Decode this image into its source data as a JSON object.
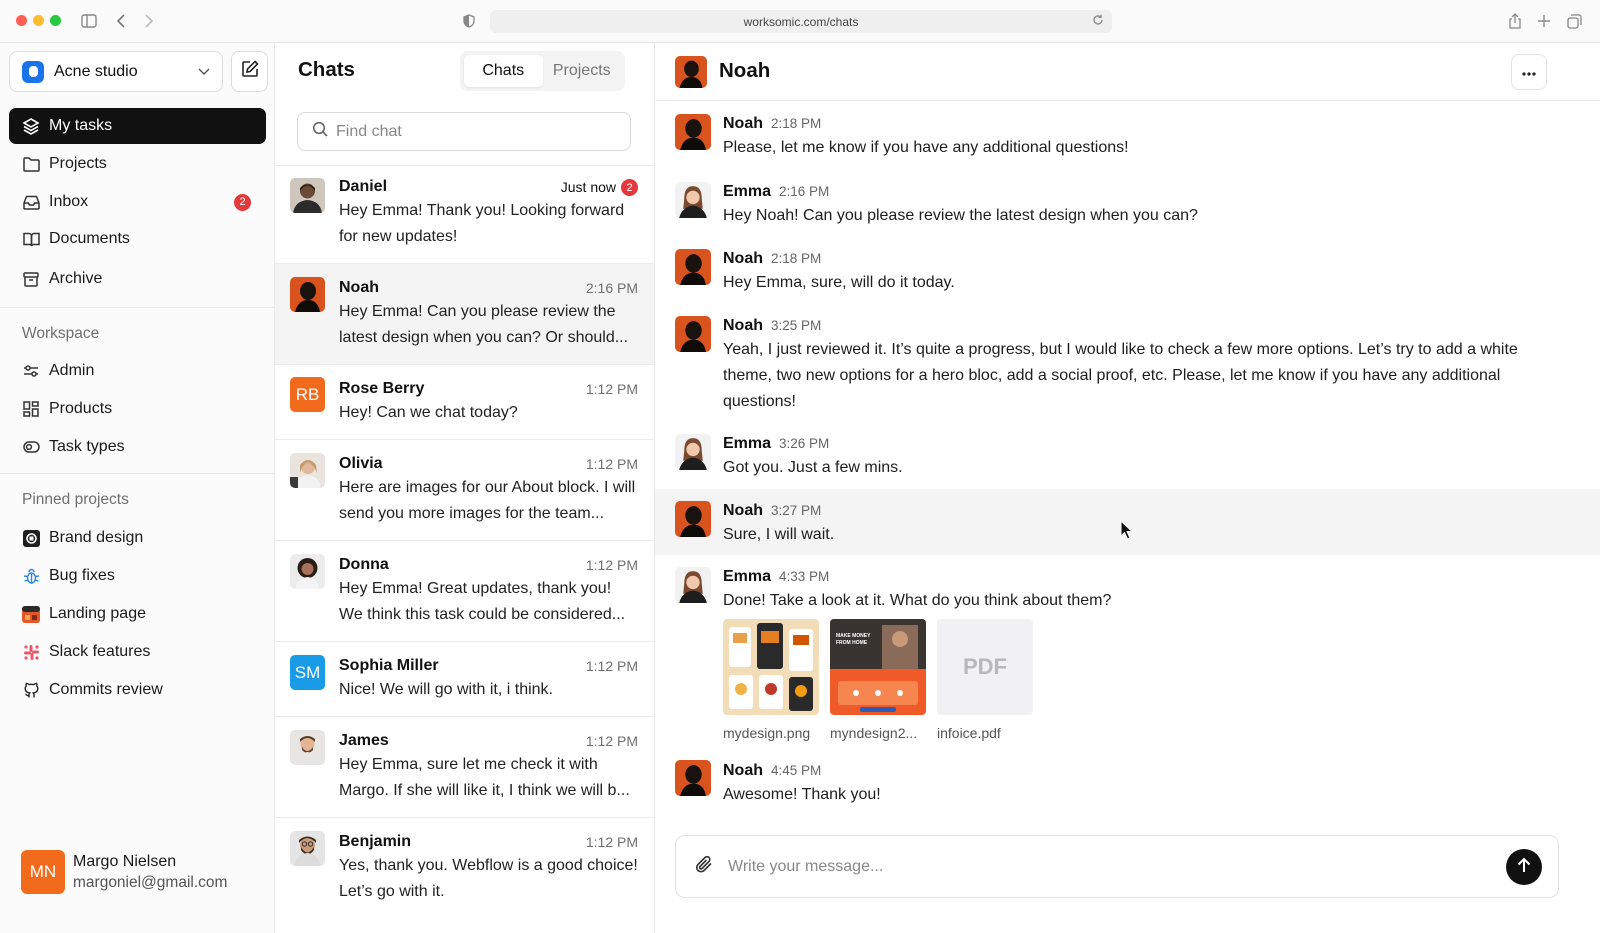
{
  "browser": {
    "url": "worksomic.com/chats"
  },
  "sidebar": {
    "workspace_name": "Acne studio",
    "nav": [
      {
        "label": "My tasks",
        "icon": "layers-icon"
      },
      {
        "label": "Projects",
        "icon": "folder-icon"
      },
      {
        "label": "Inbox",
        "icon": "inbox-icon",
        "badge": "2"
      },
      {
        "label": "Documents",
        "icon": "book-icon"
      },
      {
        "label": "Archive",
        "icon": "archive-icon"
      }
    ],
    "workspace_title": "Workspace",
    "workspace_items": [
      {
        "label": "Admin",
        "icon": "sliders-icon"
      },
      {
        "label": "Products",
        "icon": "grid-icon"
      },
      {
        "label": "Task types",
        "icon": "toggle-icon"
      }
    ],
    "pinned_title": "Pinned projects",
    "pinned_items": [
      {
        "label": "Brand design",
        "icon": "brand-design-icon"
      },
      {
        "label": "Bug fixes",
        "icon": "bug-icon"
      },
      {
        "label": "Landing page",
        "icon": "landing-page-icon"
      },
      {
        "label": "Slack features",
        "icon": "slack-icon"
      },
      {
        "label": "Commits review",
        "icon": "github-icon"
      }
    ],
    "user": {
      "initials": "MN",
      "name": "Margo Nielsen",
      "email": "margoniel@gmail.com"
    }
  },
  "chatlist": {
    "title": "Chats",
    "tabs": [
      "Chats",
      "Projects"
    ],
    "active_tab": "Chats",
    "search_placeholder": "Find chat",
    "chats": [
      {
        "name": "Daniel",
        "time": "Just now",
        "badge": "2",
        "preview": "Hey Emma! Thank you! Looking forward for new updates!"
      },
      {
        "name": "Noah",
        "time": "2:16 PM",
        "preview": "Hey Emma! Can you please review the latest design when you can? Or should..."
      },
      {
        "name": "Rose Berry",
        "initials": "RB",
        "time": "1:12 PM",
        "preview": "Hey! Can we chat today?"
      },
      {
        "name": "Olivia",
        "time": "1:12 PM",
        "preview": "Here are images for our About block. I will send you more images for the team..."
      },
      {
        "name": "Donna",
        "time": "1:12 PM",
        "preview": "Hey Emma! Great updates, thank you! We think this task could be considered..."
      },
      {
        "name": "Sophia Miller",
        "initials": "SM",
        "time": "1:12 PM",
        "preview": "Nice! We will go with it, i think."
      },
      {
        "name": "James",
        "time": "1:12 PM",
        "preview": "Hey Emma, sure let me check it with Margo. If she will like it, I think we will b..."
      },
      {
        "name": "Benjamin",
        "time": "1:12 PM",
        "preview": "Yes, thank you. Webflow is a good choice! Let’s go with it."
      }
    ]
  },
  "conversation": {
    "title": "Noah",
    "messages": [
      {
        "name": "Noah",
        "time": "2:18 PM",
        "text": "Please, let me know if you have any additional questions!"
      },
      {
        "name": "Emma",
        "time": "2:16 PM",
        "text": "Hey Noah! Can you please review the latest design when you can?"
      },
      {
        "name": "Noah",
        "time": "2:18 PM",
        "text": "Hey Emma, sure, will do it today."
      },
      {
        "name": "Noah",
        "time": "3:25 PM",
        "text": "Yeah, I just reviewed it. It’s quite a progress, but I would like to check a few more options. Let’s try to add a white theme, two new options for a hero bloc, add a social proof, etc. Please, let me know if you have any additional questions!"
      },
      {
        "name": "Emma",
        "time": "3:26 PM",
        "text": "Got you. Just a few mins."
      },
      {
        "name": "Noah",
        "time": "3:27 PM",
        "text": "Sure, I will wait."
      },
      {
        "name": "Emma",
        "time": "4:33 PM",
        "text": "Done! Take a look at it. What do you think about them?"
      },
      {
        "name": "Noah",
        "time": "4:45 PM",
        "text": "Awesome! Thank you!"
      }
    ],
    "attachments": [
      {
        "name": "mydesign.png"
      },
      {
        "name": "myndesign2...",
        "thumb_text": "MAKE MONEY FROM HOME"
      },
      {
        "name": "infoice.pdf",
        "thumb_text": "PDF"
      }
    ],
    "composer_placeholder": "Write your message..."
  },
  "colors": {
    "accent": "#111111",
    "badge": "#e5383b",
    "avatar_orange": "#f26b1d",
    "avatar_blue": "#1a9be8"
  }
}
